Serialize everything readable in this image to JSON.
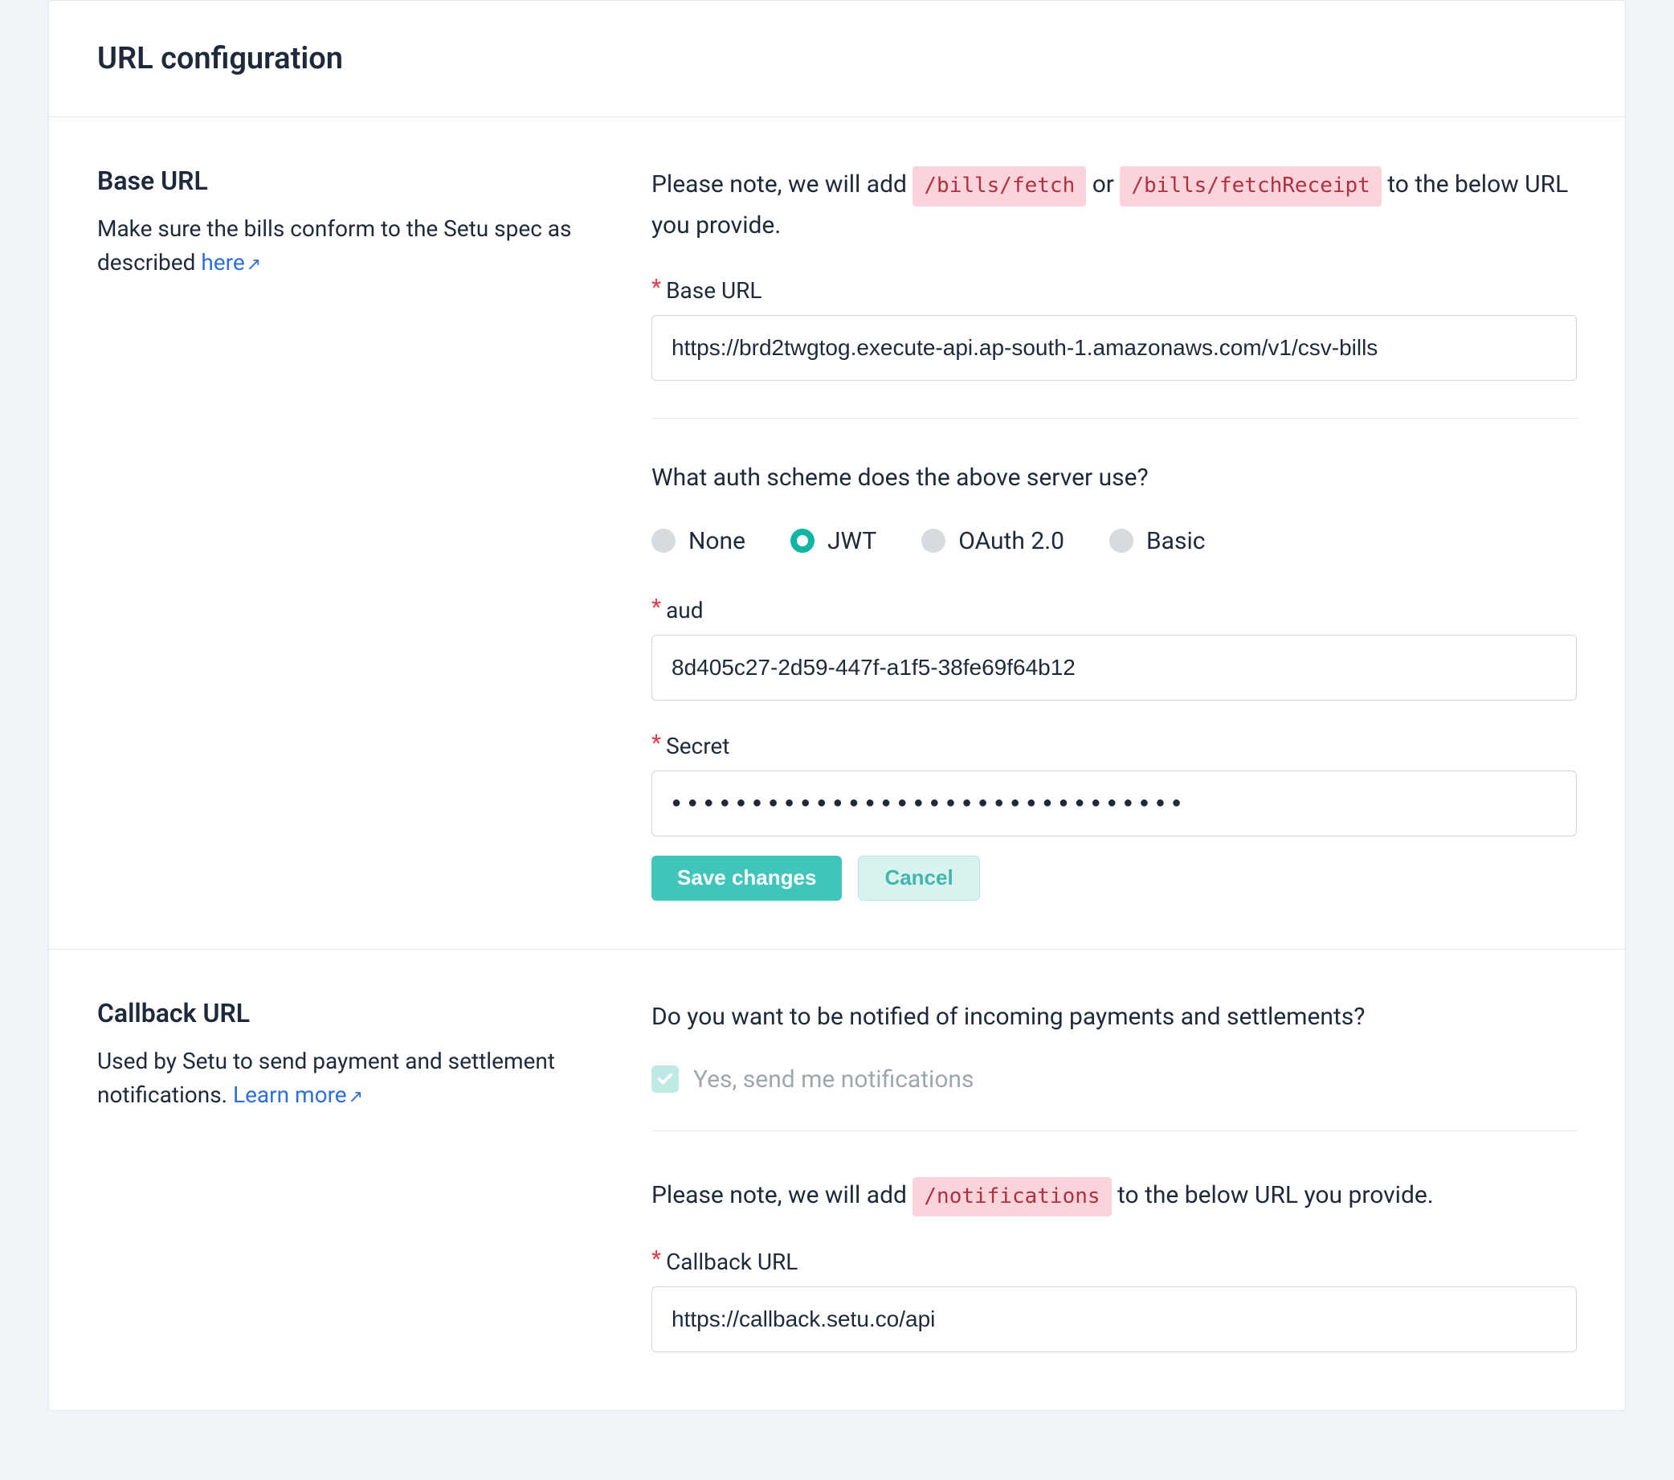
{
  "page": {
    "title": "URL configuration"
  },
  "baseUrl": {
    "heading": "Base URL",
    "desc_prefix": "Make sure the bills conform to the Setu spec as described ",
    "desc_link": "here",
    "note_prefix": "Please note, we will add ",
    "note_chip1": "/bills/fetch",
    "note_or": " or ",
    "note_chip2": "/bills/fetchReceipt",
    "note_suffix": " to the below URL you provide.",
    "field_label": "Base URL",
    "field_value": "https://brd2twgtog.execute-api.ap-south-1.amazonaws.com/v1/csv-bills",
    "auth_question": "What auth scheme does the above server use?",
    "auth_options": [
      "None",
      "JWT",
      "OAuth 2.0",
      "Basic"
    ],
    "auth_selected": "JWT",
    "aud_label": "aud",
    "aud_value": "8d405c27-2d59-447f-a1f5-38fe69f64b12",
    "secret_label": "Secret",
    "secret_value": "●●●●●●●●●●●●●●●●●●●●●●●●●●●●●●●●",
    "save_btn": "Save changes",
    "cancel_btn": "Cancel"
  },
  "callbackUrl": {
    "heading": "Callback URL",
    "desc_prefix": "Used by Setu to send payment and settlement notifications. ",
    "desc_link": "Learn more",
    "notify_question": "Do you want to be notified of incoming payments and settlements?",
    "notify_checkbox_label": "Yes, send me notifications",
    "note_prefix": "Please note, we will add ",
    "note_chip": "/notifications",
    "note_suffix": " to the below URL you provide.",
    "field_label": "Callback URL",
    "field_value": "https://callback.setu.co/api"
  }
}
